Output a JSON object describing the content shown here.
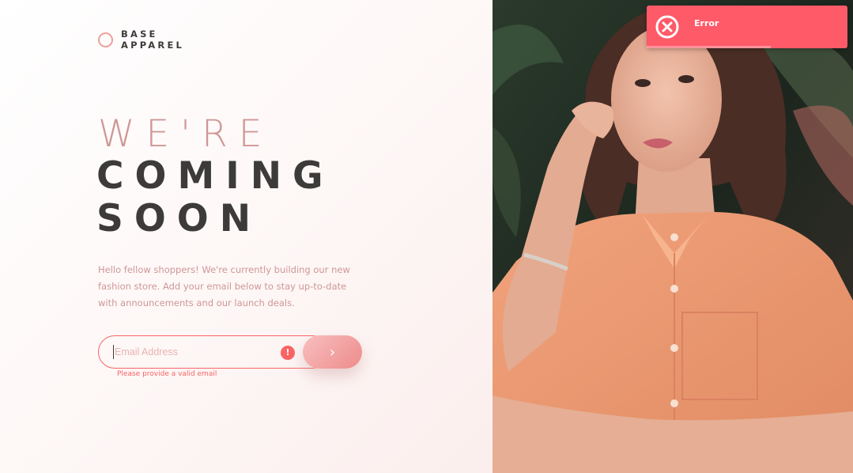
{
  "logo": {
    "line1": "BASE",
    "line2": "APPAREL"
  },
  "hero": {
    "light": "WE'RE",
    "bold_line1": "COMING",
    "bold_line2": "SOON"
  },
  "description": "Hello fellow shoppers! We're currently building our new fashion store. Add your email below to stay up-to-date with announcements and our launch deals.",
  "form": {
    "email_placeholder": "Email Address",
    "email_value": "",
    "error_icon": "!",
    "submit_icon": "›",
    "error_message": "Please provide a valid email"
  },
  "toast": {
    "title": "Error",
    "icon": "close-circle-icon"
  },
  "photo": {
    "alt": "hero-photo"
  },
  "colors": {
    "accent": "#ce9795",
    "dark": "#3d3a3a",
    "error": "#f96464",
    "toast": "#ff5a68"
  }
}
